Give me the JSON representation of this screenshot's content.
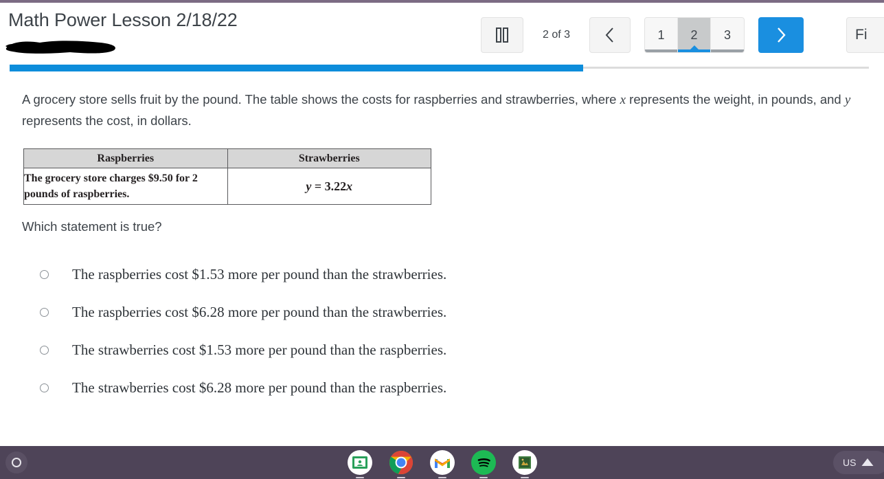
{
  "header": {
    "lesson_title": "Math Power Lesson 2/18/22",
    "redacted_subtitle": "",
    "toolbar": {
      "pause_icon": "pause-icon",
      "counter": "2 of 3",
      "prev_icon": "chevron-left-icon",
      "next_icon": "chevron-right-icon",
      "finish_label": "Fi",
      "pages": [
        "1",
        "2",
        "3"
      ],
      "active_page": "2"
    },
    "progress": {
      "percent": 66.7,
      "fill_color": "#0d8ddb",
      "track_color": "#dcdcdc"
    }
  },
  "main": {
    "prompt_part1": "A grocery store sells fruit by the pound. The table shows the costs for raspberries and strawberries, where ",
    "prompt_var_x": "x",
    "prompt_part2": " represents the weight, in pounds, and ",
    "prompt_var_y": "y",
    "prompt_part3": " represents the cost, in dollars.",
    "table": {
      "headers": [
        "Raspberries",
        "Strawberries"
      ],
      "row": {
        "raspberries_cell": "The grocery store charges $9.50 for 2 pounds of raspberries.",
        "strawberries_eq_var": "y",
        "strawberries_eq_rest": " = 3.22",
        "strawberries_eq_var2": "x"
      }
    },
    "question": "Which statement is true?",
    "options": [
      {
        "label": "The raspberries cost $1.53 more per pound than the strawberries.",
        "selected": false
      },
      {
        "label": "The raspberries cost $6.28 more per pound than the strawberries.",
        "selected": false
      },
      {
        "label": "The strawberries cost $1.53 more per pound than the raspberries.",
        "selected": false
      },
      {
        "label": "The strawberries cost $6.28 more per pound than the raspberries.",
        "selected": false
      }
    ]
  },
  "shelf": {
    "launcher_icon": "launcher-circle-icon",
    "apps": [
      {
        "name": "google-classroom",
        "icon": "classroom-icon"
      },
      {
        "name": "google-chrome",
        "icon": "chrome-icon"
      },
      {
        "name": "gmail",
        "icon": "gmail-icon"
      },
      {
        "name": "spotify",
        "icon": "spotify-icon"
      },
      {
        "name": "photo-app",
        "icon": "photo-icon"
      }
    ],
    "status": {
      "keyboard_layout": "US",
      "wifi_icon": "wifi-icon"
    }
  }
}
